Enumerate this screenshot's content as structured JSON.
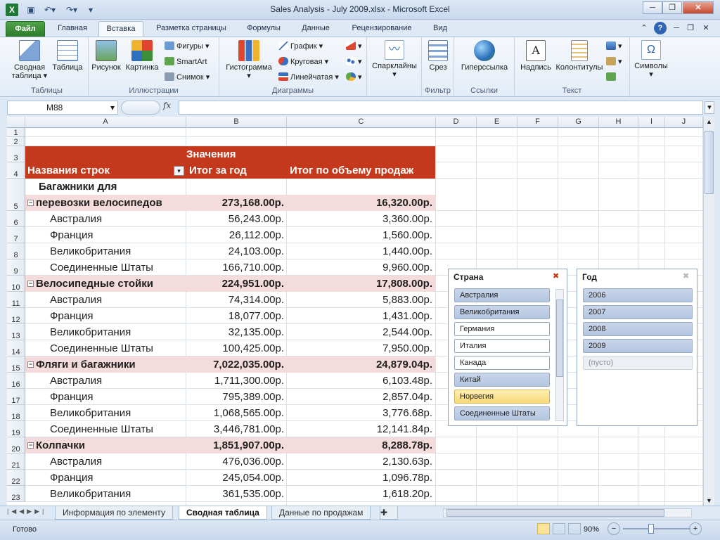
{
  "window": {
    "title": "Sales Analysis - July 2009.xlsx - Microsoft Excel"
  },
  "tabs": [
    "Файл",
    "Главная",
    "Вставка",
    "Разметка страницы",
    "Формулы",
    "Данные",
    "Рецензирование",
    "Вид"
  ],
  "ribbon": {
    "tables": {
      "label": "Таблицы",
      "pivot": "Сводная таблица",
      "table": "Таблица"
    },
    "illustrations": {
      "label": "Иллюстрации",
      "picture": "Рисунок",
      "clipart": "Картинка",
      "shapes": "Фигуры",
      "smartart": "SmartArt",
      "screenshot": "Снимок"
    },
    "charts": {
      "label": "Диаграммы",
      "column": "Гистограмма",
      "line": "График",
      "pie": "Круговая",
      "bar": "Линейчатая"
    },
    "sparklines": {
      "label": "",
      "name": "Спарклайны"
    },
    "filter": {
      "label": "Фильтр",
      "slicer": "Срез"
    },
    "links": {
      "label": "Ссылки",
      "hyperlink": "Гиперссылка"
    },
    "text": {
      "label": "Текст",
      "textbox": "Надпись",
      "headerfooter": "Колонтитулы"
    },
    "symbols": {
      "name": "Символы"
    }
  },
  "formula_bar": {
    "cell_ref": "M88",
    "fx": "fx",
    "value": ""
  },
  "columns": [
    "A",
    "B",
    "C",
    "D",
    "E",
    "F",
    "G",
    "H",
    "I",
    "J"
  ],
  "rows": [
    "1",
    "2",
    "3",
    "4",
    "5",
    "6",
    "7",
    "8",
    "9",
    "10",
    "11",
    "12",
    "13",
    "14",
    "15",
    "16",
    "17",
    "18",
    "19",
    "20",
    "21",
    "22",
    "23"
  ],
  "pivot": {
    "values_caption": "Значения",
    "row_labels": "Названия строк",
    "col_total": "Итог за год",
    "col_sales": "Итог по объему продаж",
    "data": [
      {
        "label1": "Багажники для",
        "label2": "перевозки велосипедов",
        "total": "273,168.00р.",
        "sales": "16,320.00р.",
        "group": true
      },
      {
        "label": "Австралия",
        "total": "56,243.00р.",
        "sales": "3,360.00р."
      },
      {
        "label": "Франция",
        "total": "26,112.00р.",
        "sales": "1,560.00р."
      },
      {
        "label": "Великобритания",
        "total": "24,103.00р.",
        "sales": "1,440.00р."
      },
      {
        "label": "Соединенные Штаты",
        "total": "166,710.00р.",
        "sales": "9,960.00р."
      },
      {
        "label": "Велосипедные стойки",
        "total": "224,951.00р.",
        "sales": "17,808.00р.",
        "group": true
      },
      {
        "label": "Австралия",
        "total": "74,314.00р.",
        "sales": "5,883.00р."
      },
      {
        "label": "Франция",
        "total": "18,077.00р.",
        "sales": "1,431.00р."
      },
      {
        "label": "Великобритания",
        "total": "32,135.00р.",
        "sales": "2,544.00р."
      },
      {
        "label": "Соединенные Штаты",
        "total": "100,425.00р.",
        "sales": "7,950.00р."
      },
      {
        "label": "Фляги и багажники",
        "total": "7,022,035.00р.",
        "sales": "24,879.04р.",
        "group": true
      },
      {
        "label": "Австралия",
        "total": "1,711,300.00р.",
        "sales": "6,103.48р."
      },
      {
        "label": "Франция",
        "total": "795,389.00р.",
        "sales": "2,857.04р."
      },
      {
        "label": "Великобритания",
        "total": "1,068,565.00р.",
        "sales": "3,776.68р."
      },
      {
        "label": "Соединенные Штаты",
        "total": "3,446,781.00р.",
        "sales": "12,141.84р."
      },
      {
        "label": "Колпачки",
        "total": "1,851,907.00р.",
        "sales": "8,288.78р.",
        "group": true
      },
      {
        "label": "Австралия",
        "total": "476,036.00р.",
        "sales": "2,130.63р."
      },
      {
        "label": "Франция",
        "total": "245,054.00р.",
        "sales": "1,096.78р."
      },
      {
        "label": "Великобритания",
        "total": "361,535.00р.",
        "sales": "1,618.20р."
      }
    ]
  },
  "slicer_country": {
    "title": "Страна",
    "items": [
      {
        "label": "Австралия",
        "state": "sel"
      },
      {
        "label": "Великобритания",
        "state": "sel"
      },
      {
        "label": "Германия",
        "state": "nosel"
      },
      {
        "label": "Италия",
        "state": "nosel"
      },
      {
        "label": "Канада",
        "state": "nosel"
      },
      {
        "label": "Китай",
        "state": "sel"
      },
      {
        "label": "Норвегия",
        "state": "hov"
      },
      {
        "label": "Соединенные Штаты",
        "state": "sel"
      }
    ]
  },
  "slicer_year": {
    "title": "Год",
    "items": [
      {
        "label": "2006",
        "state": "sel"
      },
      {
        "label": "2007",
        "state": "sel"
      },
      {
        "label": "2008",
        "state": "sel"
      },
      {
        "label": "2009",
        "state": "sel"
      },
      {
        "label": "(пусто)",
        "state": "empty"
      }
    ]
  },
  "sheets": [
    "Информация по элементу",
    "Сводная таблица",
    "Данные по продажам"
  ],
  "status": {
    "ready": "Готово",
    "zoom": "90%"
  },
  "colors": {
    "accent": "#c4381b",
    "group_band": "#f5dcdc",
    "slicer_selected": "#b4c6e2"
  }
}
